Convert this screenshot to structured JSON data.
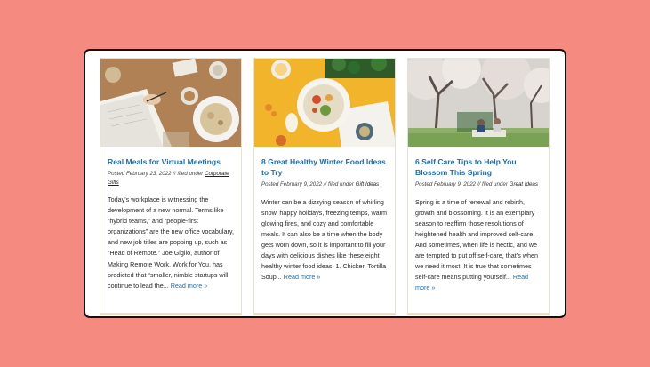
{
  "colors": {
    "background": "#f48a80",
    "link": "#1d6fb0"
  },
  "posts": [
    {
      "title": "Real Meals for Virtual Meetings",
      "meta_prefix": "Posted February 23, 2022 // filed under",
      "category": "Corporate Gifts",
      "excerpt": "Today’s workplace is witnessing the development of a new normal. Terms like “hybrid teams,” and “people-first organizations” are the new office vocabulary, and new job titles are popping up, such as “Head of Remote.” Joe Giglio, author of Making Remote Work, Work for You, has predicted that “smaller, nimble startups will continue to lead the...",
      "read_more": "Read more »",
      "image": "notebook-and-soup-photo"
    },
    {
      "title": "8 Great Healthy Winter Food Ideas to Try",
      "meta_prefix": "Posted February 9, 2022 // filed under",
      "category": "Gift Ideas",
      "excerpt": "Winter can be a dizzying season of whirling snow, happy holidays, freezing temps, warm glowing fires, and cozy and comfortable meals. It can also be a time when the body gets worn down, so it is important to fill your days with delicious dishes like these eight healthy winter food ideas. 1. Chicken Tortilla Soup...",
      "read_more": "Read more »",
      "image": "healthy-food-bowl-photo"
    },
    {
      "title": "6 Self Care Tips to Help You Blossom This Spring",
      "meta_prefix": "Posted February 9, 2022 // filed under",
      "category": "Great Ideas",
      "excerpt": "Spring is a time of renewal and rebirth, growth and blossoming. It is an exemplary season to reaffirm those resolutions of heightened health and improved self-care. And sometimes, when life is hectic, and we are tempted to put off self-care, that’s when we need it most. It is true that sometimes self-care means putting yourself...",
      "read_more": "Read more »",
      "image": "spring-picnic-blossoms-photo"
    }
  ]
}
